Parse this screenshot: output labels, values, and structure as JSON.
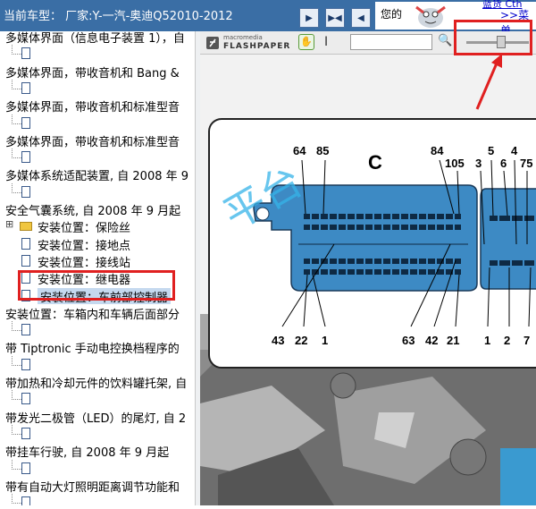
{
  "header": {
    "car_label": "当前车型： 厂家:Y-一汽-奥迪Q52010-2012",
    "notice_text": "您的",
    "notice_link_top": "蓝货 Cth",
    "notice_link": ">>菜单"
  },
  "toolbar_buttons": [
    {
      "name": "arrow-right-button",
      "glyph": "▶"
    },
    {
      "name": "expand-button",
      "glyph": "▶◀"
    },
    {
      "name": "arrow-left-button",
      "glyph": "◀"
    }
  ],
  "tree": {
    "items": [
      {
        "text": "多媒体界面（信息电子装置 1），自",
        "doc": false
      },
      {
        "text": "",
        "doc": true
      },
      {
        "text": "多媒体界面，带收音机和 Bang &",
        "doc": false
      },
      {
        "text": "",
        "doc": true
      },
      {
        "text": "多媒体界面，带收音机和标准型音",
        "doc": false
      },
      {
        "text": "",
        "doc": true
      },
      {
        "text": "多媒体界面，带收音机和标准型音",
        "doc": false
      },
      {
        "text": "",
        "doc": true
      },
      {
        "text": "多媒体系统适配装置, 自 2008 年 9",
        "doc": false
      },
      {
        "text": "",
        "doc": true
      },
      {
        "text": "安全气囊系统, 自 2008 年 9 月起",
        "doc": false
      },
      {
        "text": "安装位置：保险丝",
        "doc": false,
        "indent": true,
        "folder": true
      },
      {
        "text": "安装位置：接地点",
        "doc": true,
        "indent": true
      },
      {
        "text": "安装位置：接线站",
        "doc": true,
        "indent": true
      },
      {
        "text": "安装位置：继电器",
        "doc": true,
        "indent": true
      },
      {
        "text": "安装位置：车前部控制器",
        "doc": true,
        "indent": true,
        "selected": true
      },
      {
        "text": "安装位置：车箱内和车辆后面部分",
        "doc": false
      },
      {
        "text": "",
        "doc": true
      },
      {
        "text": "带 Tiptronic 手动电控换档程序的",
        "doc": false
      },
      {
        "text": "",
        "doc": true
      },
      {
        "text": "带加热和冷却元件的饮料罐托架, 自",
        "doc": false
      },
      {
        "text": "",
        "doc": true
      },
      {
        "text": "带发光二极管（LED）的尾灯, 自 2",
        "doc": false
      },
      {
        "text": "",
        "doc": true
      },
      {
        "text": "带挂车行驶, 自 2008 年 9 月起",
        "doc": false
      },
      {
        "text": "",
        "doc": true
      },
      {
        "text": "带有自动大灯照明距离调节功能和",
        "doc": false
      },
      {
        "text": "",
        "doc": true
      }
    ]
  },
  "viewer": {
    "logo_small": "macromedia",
    "logo_big": "FLASHPAPER",
    "search_value": "",
    "zoom_level": 0.55
  },
  "diagram": {
    "connector_letter": "C",
    "watermark": "平台",
    "top_pins": [
      "64",
      "85",
      "84",
      "105",
      "3",
      "5",
      "6",
      "4",
      "75"
    ],
    "bottom_pins": [
      "43",
      "22",
      "1",
      "63",
      "42",
      "21",
      "1",
      "2",
      "7"
    ]
  },
  "colors": {
    "titlebar": "#3a6ea5",
    "selection": "#c5d9ef",
    "highlight": "#e02020",
    "connector": "#3d8ac4"
  }
}
